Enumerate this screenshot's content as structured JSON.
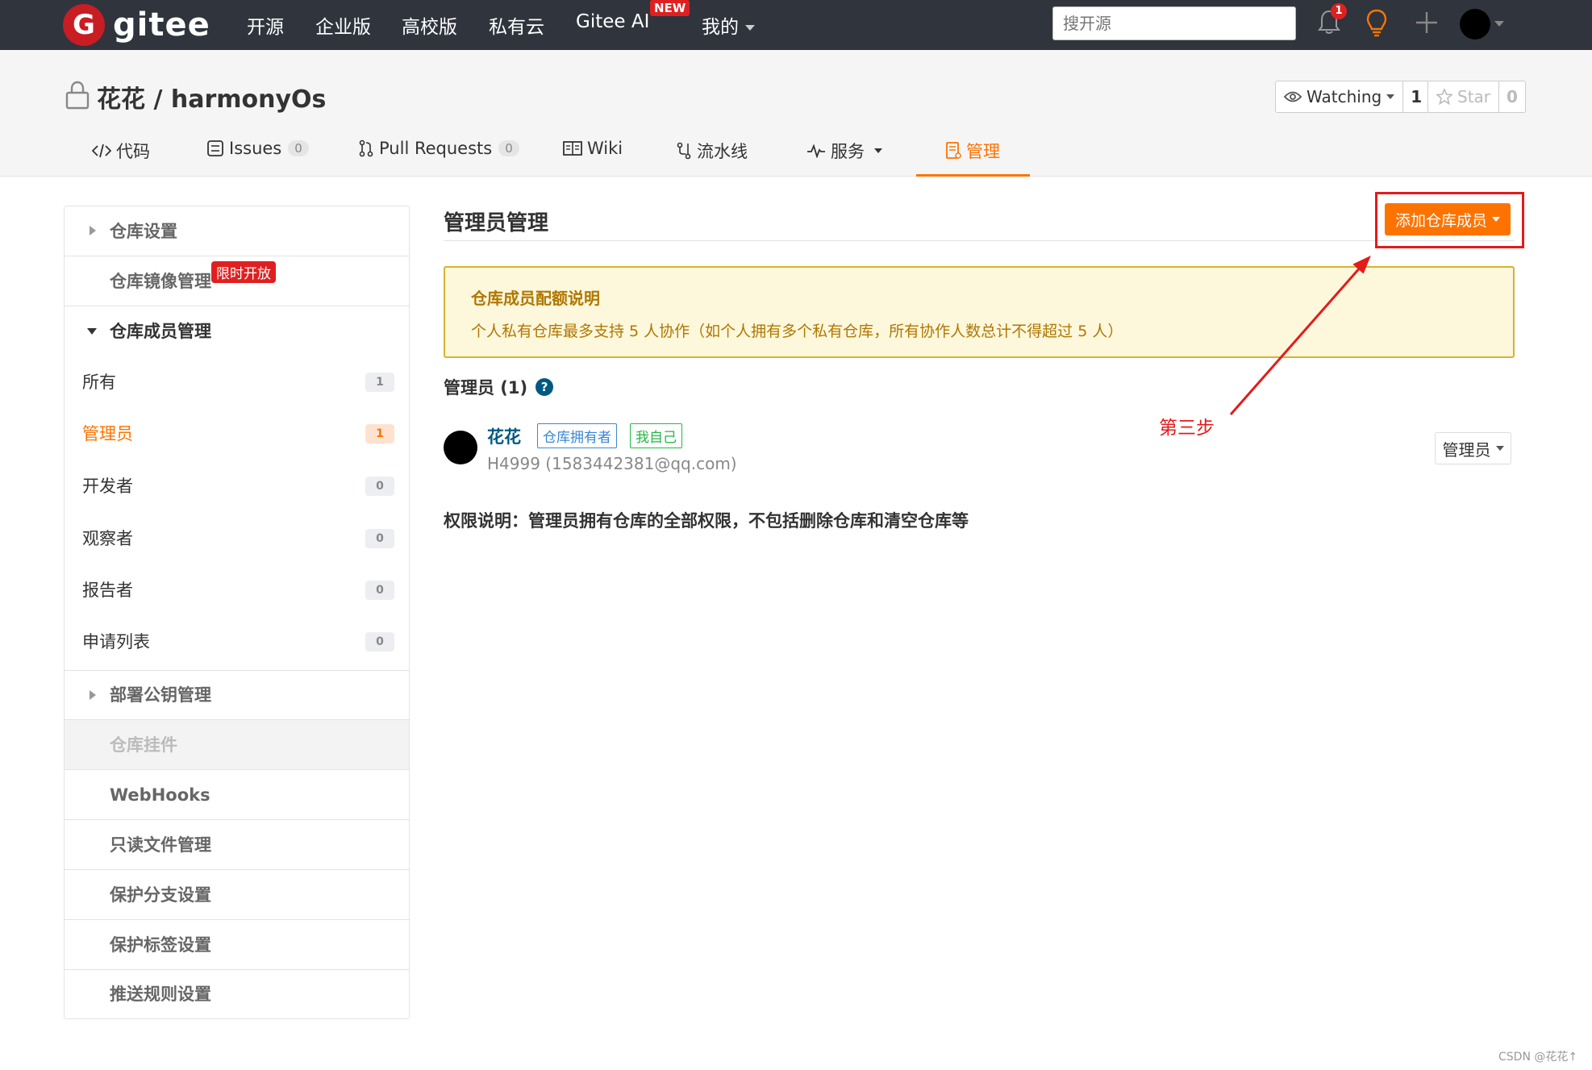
{
  "topnav": {
    "logo_text": "gitee",
    "items": [
      "开源",
      "企业版",
      "高校版",
      "私有云",
      "Gitee AI",
      "我的"
    ],
    "new_badge": "NEW",
    "search_placeholder": "搜开源",
    "notification_count": "1"
  },
  "repo": {
    "title": "花花 / harmonyOs",
    "watching_label": "Watching",
    "watching_count": "1",
    "star_label": "Star",
    "star_count": "0"
  },
  "tabs": [
    {
      "label": "代码"
    },
    {
      "label": "Issues",
      "count": "0"
    },
    {
      "label": "Pull Requests",
      "count": "0"
    },
    {
      "label": "Wiki"
    },
    {
      "label": "流水线"
    },
    {
      "label": "服务"
    },
    {
      "label": "管理"
    }
  ],
  "sidebar": {
    "repo_settings": "仓库设置",
    "mirror_management": "仓库镜像管理",
    "limited_badge": "限时开放",
    "member_management": "仓库成员管理",
    "members": [
      {
        "label": "所有",
        "count": "1"
      },
      {
        "label": "管理员",
        "count": "1"
      },
      {
        "label": "开发者",
        "count": "0"
      },
      {
        "label": "观察者",
        "count": "0"
      },
      {
        "label": "报告者",
        "count": "0"
      },
      {
        "label": "申请列表",
        "count": "0"
      }
    ],
    "deploy_keys": "部署公钥管理",
    "repo_plugins": "仓库挂件",
    "webhooks": "WebHooks",
    "readonly_files": "只读文件管理",
    "protected_branches": "保护分支设置",
    "protected_tags": "保护标签设置",
    "push_rules": "推送规则设置"
  },
  "main": {
    "title": "管理员管理",
    "add_member_button": "添加仓库成员",
    "notice_title": "仓库成员配额说明",
    "notice_body": "个人私有仓库最多支持 5 人协作（如个人拥有多个私有仓库，所有协作人数总计不得超过 5 人）",
    "admins_label": "管理员 (1)",
    "help_icon": "?",
    "member": {
      "name": "花花",
      "tag_owner": "仓库拥有者",
      "tag_self": "我自己",
      "sub": "H4999 (1583442381@qq.com)",
      "role": "管理员"
    },
    "permission_note": "权限说明：管理员拥有仓库的全部权限，不包括删除仓库和清空仓库等"
  },
  "annotation": {
    "text": "第三步"
  },
  "watermark": "CSDN @花花↑",
  "colors": {
    "accent": "#fe7300",
    "navbar": "#2f343d",
    "brand_red": "#c71d23",
    "link_blue": "#005980",
    "annotation_red": "#e31b1b"
  }
}
